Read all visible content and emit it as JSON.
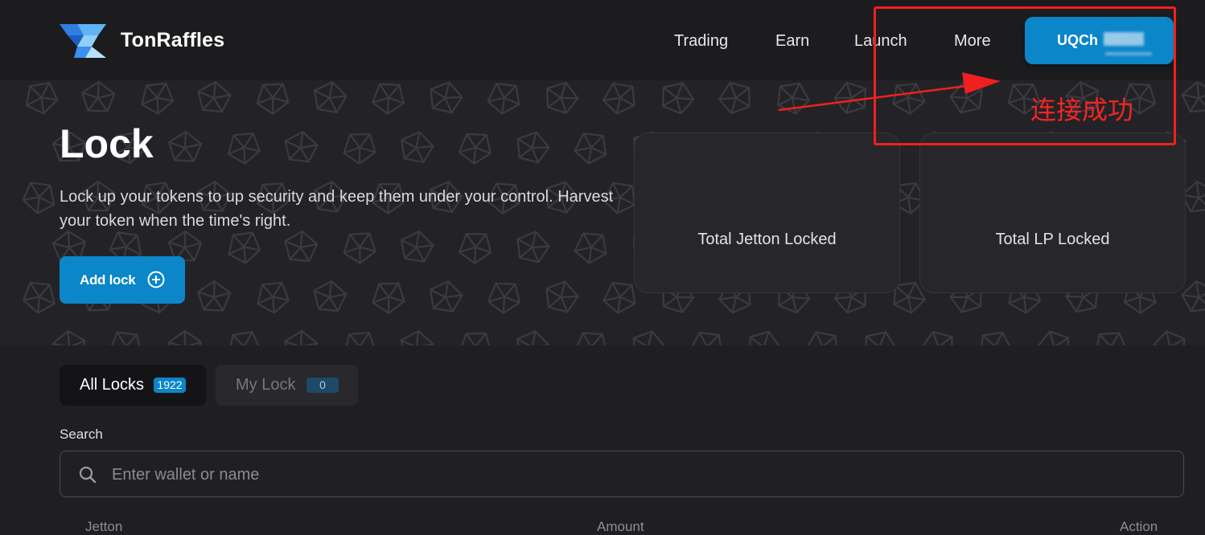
{
  "header": {
    "brand": "TonRaffles",
    "nav": [
      "Trading",
      "Earn",
      "Launch",
      "More"
    ],
    "wallet_label": "UQCh"
  },
  "hero": {
    "title": "Lock",
    "description": "Lock up your tokens to up security and keep them under your control. Harvest your token when the time's right.",
    "add_lock_label": "Add lock",
    "stats": [
      {
        "label": "Total Jetton Locked"
      },
      {
        "label": "Total LP Locked"
      }
    ]
  },
  "tabs": [
    {
      "label": "All Locks",
      "count": "1922",
      "active": true
    },
    {
      "label": "My Lock",
      "count": "0",
      "active": false
    }
  ],
  "search": {
    "label": "Search",
    "placeholder": "Enter wallet or name"
  },
  "table": {
    "columns": [
      "Jetton",
      "Amount",
      "Action"
    ]
  },
  "annotation": {
    "text": "连接成功",
    "color": "#f02020"
  },
  "colors": {
    "accent": "#0a86c9",
    "background": "#1f1f23"
  }
}
